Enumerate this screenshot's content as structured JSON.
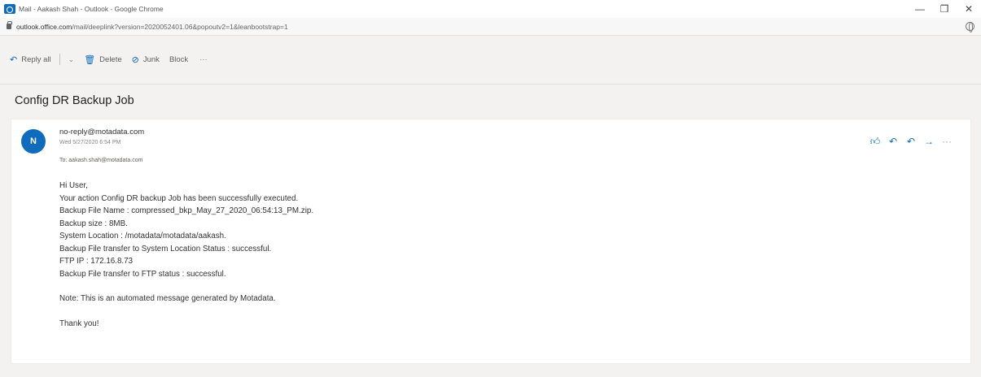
{
  "window": {
    "title": "Mail - Aakash Shah - Outlook - Google Chrome",
    "controls": {
      "minimize": "—",
      "maximize": "❐",
      "close": "✕"
    }
  },
  "address": {
    "host": "outlook.office.com",
    "path": "/mail/deeplink?version=2020052401.06&popoutv2=1&leanbootstrap=1"
  },
  "toolbar": {
    "reply_all": "Reply all",
    "delete": "Delete",
    "junk": "Junk",
    "block": "Block",
    "more": "···"
  },
  "message": {
    "subject": "Config DR Backup Job",
    "avatar_initial": "N",
    "sender": "no-reply@motadata.com",
    "date": "Wed 5/27/2020 6:54 PM",
    "to": "To: aakash.shah@motadata.com",
    "body": {
      "greeting": "Hi User,",
      "lines": [
        "Your action Config DR backup Job has been successfully executed.",
        "Backup File Name : compressed_bkp_May_27_2020_06:54:13_PM.zip.",
        "Backup size : 8MB.",
        "System Location : /motadata/motadata/aakash.",
        "Backup File transfer to System Location Status : successful.",
        "FTP IP : 172.16.8.73",
        "Backup File transfer to FTP status : successful."
      ],
      "note": "Note: This is an automated message generated by Motadata.",
      "closing": "Thank you!"
    }
  },
  "icons": {
    "like": "like-icon",
    "reply": "reply-icon",
    "reply_all": "reply-all-icon",
    "forward": "forward-icon",
    "more": "more-icon"
  },
  "colors": {
    "accent": "#0f6cbd",
    "background": "#f3f2f1"
  }
}
